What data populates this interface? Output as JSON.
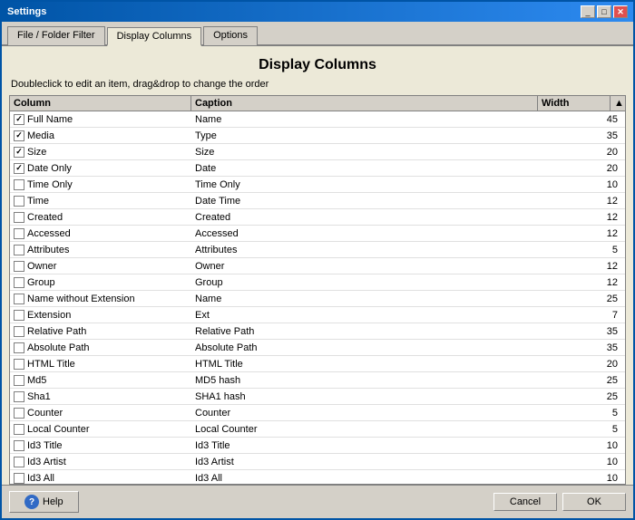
{
  "window": {
    "title": "Settings",
    "title_buttons": [
      "_",
      "□",
      "✕"
    ]
  },
  "tabs": [
    {
      "label": "File / Folder Filter",
      "active": false
    },
    {
      "label": "Display Columns",
      "active": true
    },
    {
      "label": "Options",
      "active": false
    }
  ],
  "page_title": "Display Columns",
  "subtitle": "Doubleclick to edit an item, drag&drop to change the order",
  "table": {
    "headers": [
      "Column",
      "Caption",
      "Width"
    ],
    "rows": [
      {
        "checked": true,
        "column": "Full Name",
        "caption": "Name",
        "width": "45"
      },
      {
        "checked": true,
        "column": "Media",
        "caption": "Type",
        "width": "35"
      },
      {
        "checked": true,
        "column": "Size",
        "caption": "Size",
        "width": "20"
      },
      {
        "checked": true,
        "column": "Date Only",
        "caption": "Date",
        "width": "20"
      },
      {
        "checked": false,
        "column": "Time Only",
        "caption": "Time Only",
        "width": "10"
      },
      {
        "checked": false,
        "column": "Time",
        "caption": "Date Time",
        "width": "12"
      },
      {
        "checked": false,
        "column": "Created",
        "caption": "Created",
        "width": "12"
      },
      {
        "checked": false,
        "column": "Accessed",
        "caption": "Accessed",
        "width": "12"
      },
      {
        "checked": false,
        "column": "Attributes",
        "caption": "Attributes",
        "width": "5"
      },
      {
        "checked": false,
        "column": "Owner",
        "caption": "Owner",
        "width": "12"
      },
      {
        "checked": false,
        "column": "Group",
        "caption": "Group",
        "width": "12"
      },
      {
        "checked": false,
        "column": "Name without Extension",
        "caption": "Name",
        "width": "25"
      },
      {
        "checked": false,
        "column": "Extension",
        "caption": "Ext",
        "width": "7"
      },
      {
        "checked": false,
        "column": "Relative Path",
        "caption": "Relative Path",
        "width": "35"
      },
      {
        "checked": false,
        "column": "Absolute Path",
        "caption": "Absolute Path",
        "width": "35"
      },
      {
        "checked": false,
        "column": "HTML Title",
        "caption": "HTML Title",
        "width": "20"
      },
      {
        "checked": false,
        "column": "Md5",
        "caption": "MD5 hash",
        "width": "25"
      },
      {
        "checked": false,
        "column": "Sha1",
        "caption": "SHA1 hash",
        "width": "25"
      },
      {
        "checked": false,
        "column": "Counter",
        "caption": "Counter",
        "width": "5"
      },
      {
        "checked": false,
        "column": "Local Counter",
        "caption": "Local Counter",
        "width": "5"
      },
      {
        "checked": false,
        "column": "Id3 Title",
        "caption": "Id3 Title",
        "width": "10"
      },
      {
        "checked": false,
        "column": "Id3 Artist",
        "caption": "Id3 Artist",
        "width": "10"
      },
      {
        "checked": false,
        "column": "Id3 All",
        "caption": "Id3 All",
        "width": "10"
      }
    ]
  },
  "footer": {
    "help_label": "Help",
    "cancel_label": "Cancel",
    "ok_label": "OK"
  }
}
